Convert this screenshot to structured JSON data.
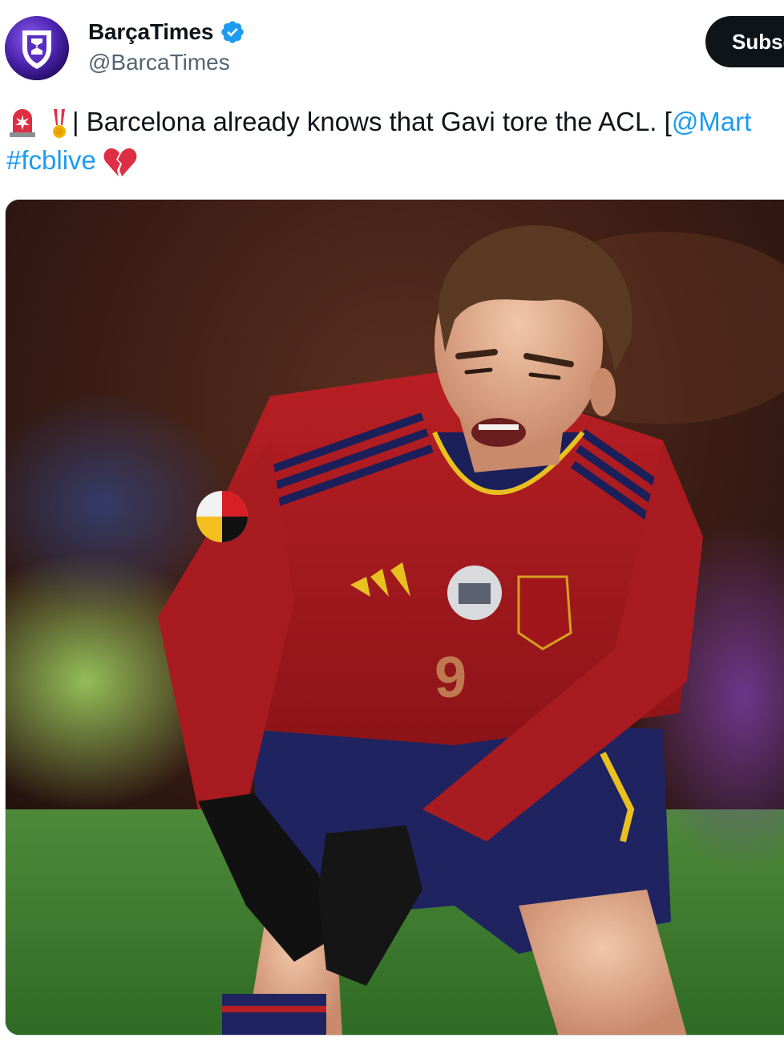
{
  "author": {
    "display_name": "BarçaTimes",
    "handle": "@BarcaTimes",
    "verified": true,
    "avatar_icon": "barcatimes-logo-icon"
  },
  "actions": {
    "subscribe_label": "Subscribe"
  },
  "tweet": {
    "emoji_1": "rotating-light-emoji",
    "emoji_2": "military-medal-emoji",
    "text": "| Barcelona already knows that Gavi tore the ACL. [",
    "mention": "@Mart",
    "hashtag": "#fcblive",
    "emoji_3": "broken-heart-emoji"
  },
  "media": {
    "icon": "photo-gavi-injury",
    "shirt_number": "9"
  },
  "colors": {
    "link": "#1d9bf0",
    "verified": "#1d9bf0",
    "button_bg": "#0f1419",
    "handle": "#536471",
    "avatar": "#4b22a8"
  }
}
